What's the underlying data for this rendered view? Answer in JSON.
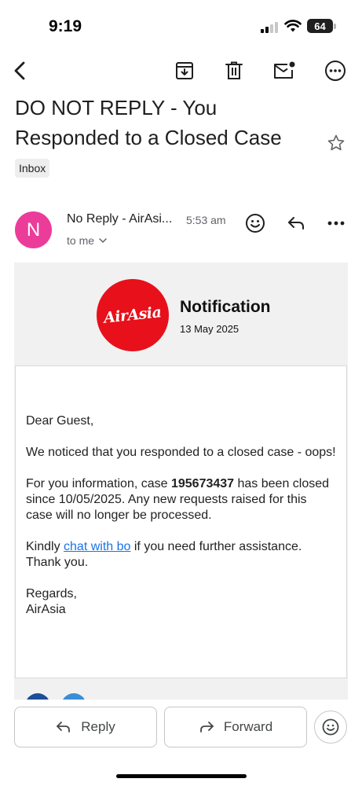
{
  "status_bar": {
    "time": "9:19",
    "battery": "64"
  },
  "toolbar": {
    "back_icon": "chevron-left-icon",
    "archive_icon": "archive-icon",
    "delete_icon": "trash-icon",
    "mark_unread_icon": "mail-unread-icon",
    "more_icon": "more-circle-icon"
  },
  "email": {
    "subject": "DO NOT REPLY - You Responded to a Closed Case",
    "label": "Inbox",
    "sender": {
      "initial": "N",
      "name": "No Reply - AirAsi...",
      "time": "5:53 am",
      "recipient": "to me",
      "avatar_color": "#ec3c9a"
    }
  },
  "body": {
    "logo_text": "AirAsia",
    "logo_color": "#e8101a",
    "notification_title": "Notification",
    "notification_date": "13 May 2025",
    "greeting": "Dear Guest,",
    "para1": "We noticed that you responded to a closed case - oops!",
    "para2_prefix": "For you information, case ",
    "case_number": "195673437",
    "para2_suffix": " has been closed since 10/05/2025. Any new requests raised for this case will no longer be processed.",
    "para3_prefix": "Kindly ",
    "link_text": "chat with bo",
    "para3_suffix": " if you need further assistance. Thank you.",
    "regards": "Regards,",
    "signature": "AirAsia",
    "link_color": "#1a73e8"
  },
  "actions": {
    "reply_label": "Reply",
    "forward_label": "Forward"
  }
}
